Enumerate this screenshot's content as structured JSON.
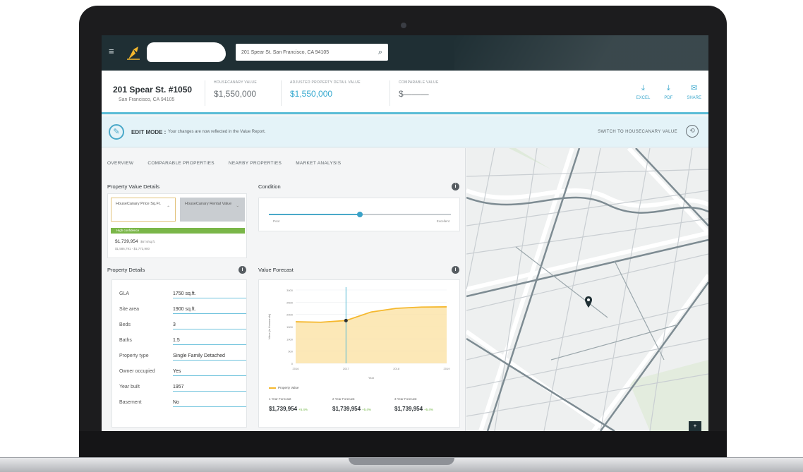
{
  "search": {
    "value": "201 Spear St. San Francisco, CA 94105"
  },
  "property": {
    "address": "201 Spear St. #1050",
    "city": "San Francisco, CA 94105"
  },
  "metrics": [
    {
      "label": "HOUSECANARY VALUE",
      "value": "$1,550,000"
    },
    {
      "label": "ADJUSTED PROPERTY DETAIL VALUE",
      "value": "$1,550,000"
    },
    {
      "label": "COMPARABLE VALUE",
      "value": "$———"
    }
  ],
  "actions": [
    {
      "label": "EXCEL",
      "icon": "download-icon"
    },
    {
      "label": "PDF",
      "icon": "download-icon"
    },
    {
      "label": "SHARE",
      "icon": "mail-icon"
    }
  ],
  "edit_mode": {
    "title": "EDIT MODE :",
    "message": "Your changes are now reflected in the Value Report.",
    "switch_label": "SWITCH TO HOUSECANARY VALUE"
  },
  "tabs": [
    "OVERVIEW",
    "COMPARABLE PROPERTIES",
    "NEARBY PROPERTIES",
    "MARKET ANALYSIS"
  ],
  "property_value_details": {
    "title": "Property Value Details",
    "select_1": "HouseCanary Price Sq.Ft.",
    "select_2": "HouseCanary Rental Value",
    "confidence": "High confidence",
    "value": "$1,739,954",
    "value_note": "$674/sq.ft.",
    "range": "$1,586,791 - $1,773,900"
  },
  "condition": {
    "title": "Condition",
    "low_label": "Poor",
    "high_label": "Excellent",
    "level": 0.5
  },
  "property_details": {
    "title": "Property Details",
    "rows": [
      {
        "k": "GLA",
        "v": "1750 sq.ft."
      },
      {
        "k": "Site area",
        "v": "1900 sq.ft."
      },
      {
        "k": "Beds",
        "v": "3"
      },
      {
        "k": "Baths",
        "v": "1.5"
      },
      {
        "k": "Property type",
        "v": "Single Family Detached"
      },
      {
        "k": "Owner occupied",
        "v": "Yes"
      },
      {
        "k": "Year built",
        "v": "1957"
      },
      {
        "k": "Basement",
        "v": "No"
      }
    ]
  },
  "value_forecast": {
    "title": "Value Forecast",
    "legend": "Property Value",
    "forecasts": [
      {
        "label": "1 Year Forecast",
        "value": "$1,739,954",
        "pct": "+5.4%"
      },
      {
        "label": "2 Year Forecast",
        "value": "$1,739,954",
        "pct": "+5.4%"
      },
      {
        "label": "3 Year Forecast",
        "value": "$1,739,954",
        "pct": "+5.4%"
      }
    ]
  },
  "chart_data": {
    "type": "area",
    "title": "",
    "xlabel": "Year",
    "ylabel": "Value (in thousands)",
    "x": [
      2016,
      2016.5,
      2017,
      2017.5,
      2018,
      2018.5,
      2019
    ],
    "categories": [
      "2016",
      "2017",
      "2018",
      "2019"
    ],
    "yticks": [
      0,
      500,
      1000,
      1500,
      2000,
      2500,
      3000
    ],
    "ylim": [
      0,
      3000
    ],
    "series": [
      {
        "name": "Property Value",
        "values": [
          1700,
          1680,
          1750,
          2100,
          2250,
          2300,
          2310
        ]
      }
    ],
    "marker_x": 2017,
    "colors": {
      "line": "#f5b82e",
      "fill": "#fbe2a5",
      "cursor": "#5bbcd6"
    }
  },
  "colors": {
    "accent": "#36a9cf",
    "topbar": "#1f2f34",
    "confidence": "#7ab648"
  }
}
